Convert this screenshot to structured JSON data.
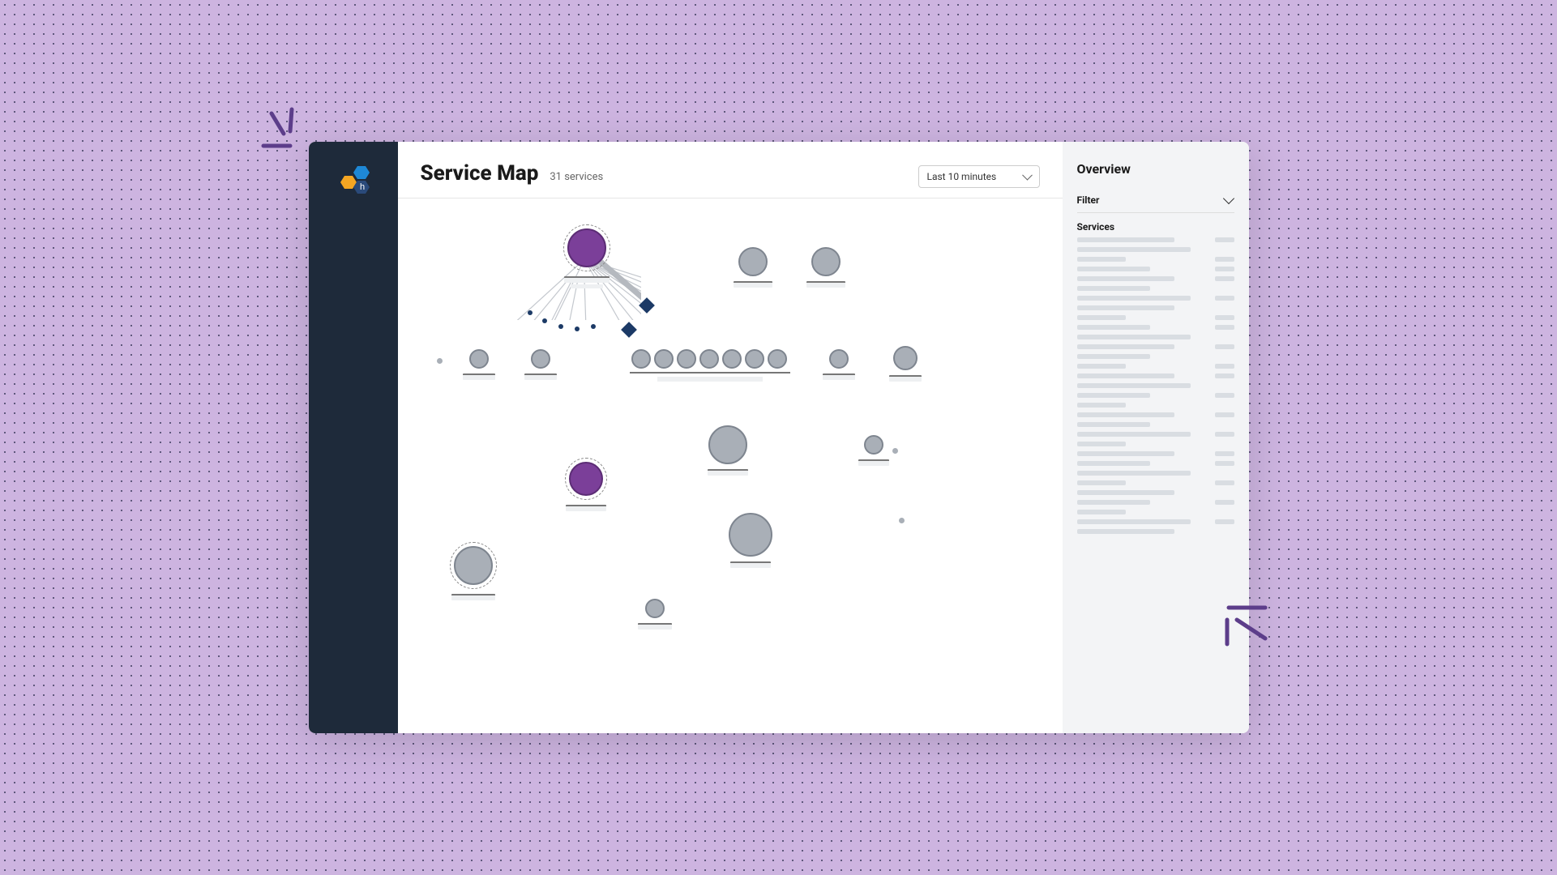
{
  "header": {
    "page_title": "Service Map",
    "service_count": "31 services",
    "time_range": "Last 10 minutes"
  },
  "right_panel": {
    "overview_label": "Overview",
    "filter_label": "Filter",
    "services_label": "Services"
  },
  "colors": {
    "accent_purple": "#7b3f99",
    "node_gray": "#a9afb7",
    "navy": "#1c3a66",
    "sidebar_bg": "#1e2a3a",
    "page_bg": "#cdb4e0"
  },
  "logo_letter": "h"
}
